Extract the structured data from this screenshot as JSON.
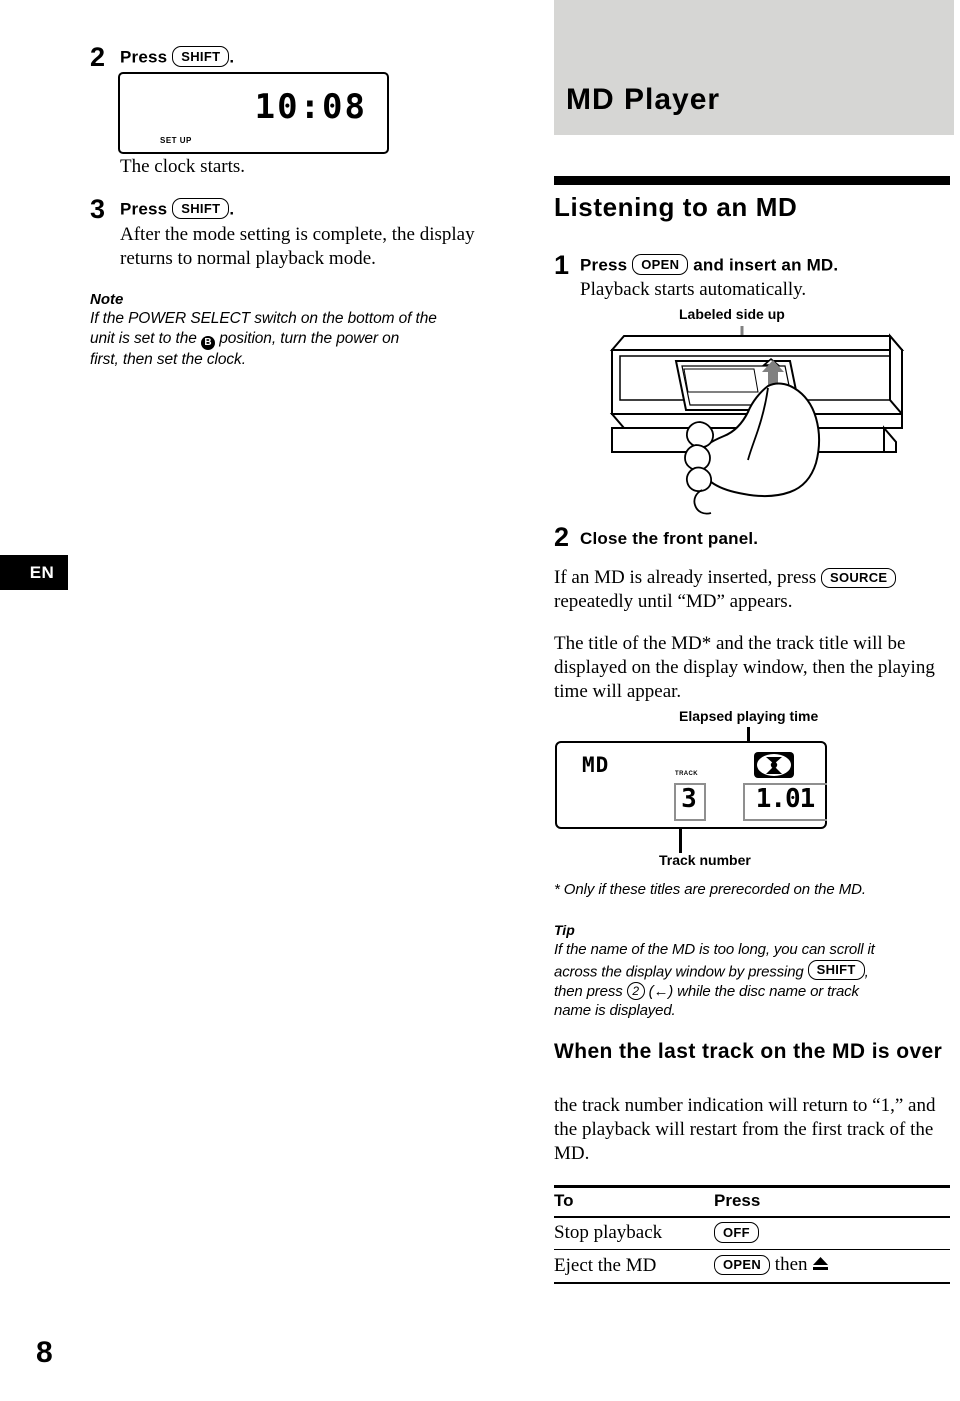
{
  "page": {
    "number": "8",
    "lang_tab": "EN"
  },
  "left_column": {
    "step2": {
      "number": "2",
      "head_prefix": "Press",
      "key": "SHIFT",
      "head_suffix": ".",
      "lcd": {
        "time": "10:08",
        "setup_label": "SET UP"
      },
      "caption": "The clock starts."
    },
    "step3": {
      "number": "3",
      "head_prefix": "Press",
      "key": "SHIFT",
      "head_suffix": ".",
      "body": "After the mode setting is complete, the display returns to normal playback mode."
    },
    "note": {
      "title": "Note",
      "line1": "If the POWER SELECT switch on the bottom of the",
      "line2_before": "unit is set to the",
      "badge": "B",
      "line2_after": "position, turn the power on",
      "line3": "first, then set the clock."
    }
  },
  "right_column": {
    "chapter_title": "MD Player",
    "section_title": "Listening to an MD",
    "step1": {
      "number": "1",
      "head_prefix": "Press",
      "key": "OPEN",
      "head_suffix": "and insert an MD.",
      "body": "Playback starts automatically."
    },
    "illustration": {
      "callout_label": "Labeled side up"
    },
    "step2": {
      "number": "2",
      "head": "Close the front panel.",
      "para1_before": "If an MD is already inserted, press",
      "para1_key": "SOURCE",
      "para1_after": "repeatedly until “MD” appears.",
      "para2": "The title of the MD* and the track title will be displayed on the display window, then the playing time will appear."
    },
    "display": {
      "callout_top": "Elapsed playing time",
      "callout_bottom": "Track number",
      "source_label": "MD",
      "track_word": "TRACK",
      "track_number": "3",
      "elapsed_time": "1.01",
      "disc_icon": "disc-icon"
    },
    "footnote": "* Only if these titles are prerecorded on the MD.",
    "tip": {
      "title": "Tip",
      "line1": "If the name of the MD is too long, you can scroll it",
      "line2_before": "across the display window by pressing",
      "line2_key": "SHIFT",
      "line2_after": ",",
      "line3_before": "then press",
      "line3_round_key": "2",
      "line3_mid": "(←) while the disc name or track",
      "line4": "name is displayed."
    },
    "last_track": {
      "heading": "When the last track on the MD is over",
      "body": "the track number indication will return to “1,” and the playback will restart from the first track of the MD."
    },
    "table": {
      "headers": [
        "To",
        "Press"
      ],
      "rows": [
        {
          "action": "Stop playback",
          "key": "OFF",
          "suffix": "",
          "eject": false
        },
        {
          "action": "Eject the MD",
          "key": "OPEN",
          "suffix": "then",
          "eject": true
        }
      ]
    }
  }
}
